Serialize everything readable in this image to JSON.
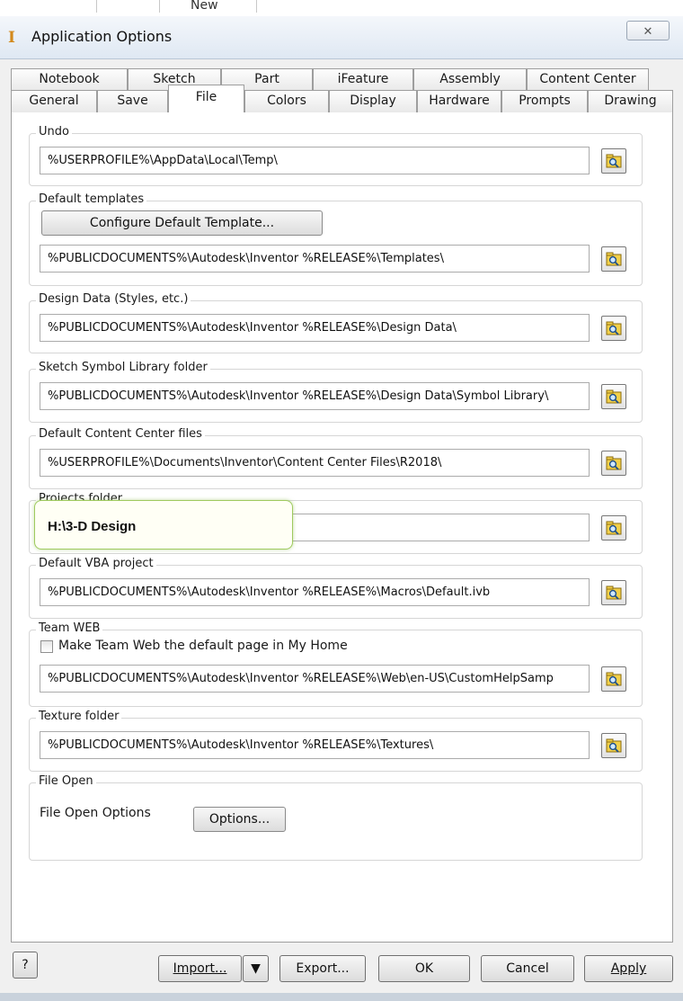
{
  "background_window": {
    "tab_fragment": "New"
  },
  "titlebar": {
    "title": "Application Options",
    "app_icon": "inventor-app-icon",
    "close_glyph": "✕"
  },
  "tabs": {
    "back_row": [
      "Notebook",
      "Sketch",
      "Part",
      "iFeature",
      "Assembly",
      "Content Center"
    ],
    "front_row": [
      "General",
      "Save",
      "File",
      "Colors",
      "Display",
      "Hardware",
      "Prompts",
      "Drawing"
    ],
    "active": "File"
  },
  "groups": {
    "undo": {
      "label": "Undo",
      "path": "%USERPROFILE%\\AppData\\Local\\Temp\\"
    },
    "templates": {
      "label": "Default templates",
      "configure_button": "Configure Default Template...",
      "path": "%PUBLICDOCUMENTS%\\Autodesk\\Inventor %RELEASE%\\Templates\\"
    },
    "design_data": {
      "label": "Design Data (Styles, etc.)",
      "path": "%PUBLICDOCUMENTS%\\Autodesk\\Inventor %RELEASE%\\Design Data\\"
    },
    "symbol_library": {
      "label": "Sketch Symbol Library folder",
      "path": "%PUBLICDOCUMENTS%\\Autodesk\\Inventor %RELEASE%\\Design Data\\Symbol Library\\"
    },
    "content_center": {
      "label": "Default Content Center files",
      "path": "%USERPROFILE%\\Documents\\Inventor\\Content Center Files\\R2018\\"
    },
    "projects": {
      "label": "Projects folder",
      "path": "",
      "highlight_callout": "H:\\3-D Design"
    },
    "vba": {
      "label": "Default VBA project",
      "path": "%PUBLICDOCUMENTS%\\Autodesk\\Inventor %RELEASE%\\Macros\\Default.ivb"
    },
    "team_web": {
      "label": "Team WEB",
      "checkbox_label": "Make Team Web the default page in My Home",
      "checked": false,
      "path": "%PUBLICDOCUMENTS%\\Autodesk\\Inventor %RELEASE%\\Web\\en-US\\CustomHelpSamp"
    },
    "texture": {
      "label": "Texture folder",
      "path": "%PUBLICDOCUMENTS%\\Autodesk\\Inventor %RELEASE%\\Textures\\"
    },
    "file_open": {
      "label": "File Open",
      "options_label": "File Open Options",
      "options_button": "Options..."
    }
  },
  "footer": {
    "help_glyph": "?",
    "import": "Import...",
    "export": "Export...",
    "ok": "OK",
    "cancel": "Cancel",
    "apply": "Apply"
  },
  "colors": {
    "highlight_border": "#9fca5f",
    "titlebar": "#dfe8f3",
    "dialog": "#f0f0f0"
  }
}
